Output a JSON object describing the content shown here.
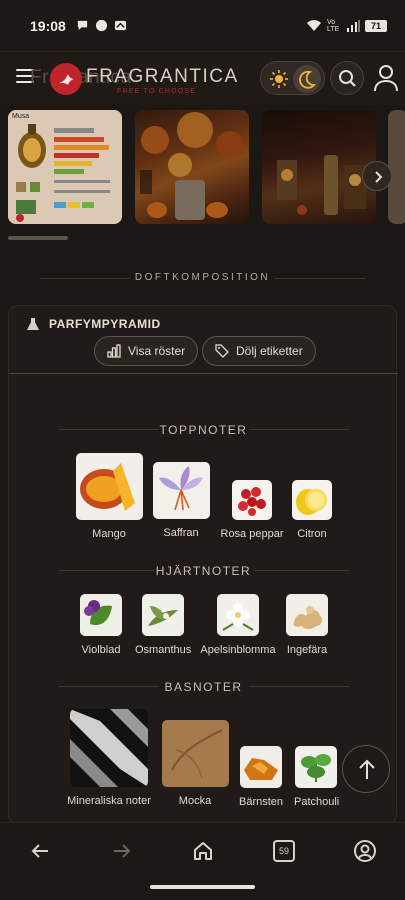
{
  "status_bar": {
    "time": "19:08",
    "network_label": "Vo LTE",
    "battery": "71"
  },
  "header": {
    "ghost_title": "Fragrantica",
    "brand": "FRAGRANTICA",
    "tagline": "FREE TO CHOOSE",
    "brand_color": "#c0242b"
  },
  "carousel": {
    "thumb1_title": "Musa"
  },
  "section": {
    "title": "DOFTKOMPOSITION"
  },
  "pyramid": {
    "title": "PARFYMPYRAMID",
    "show_votes_label": "Visa röster",
    "hide_tags_label": "Dölj etiketter",
    "top": {
      "title": "TOPPNOTER",
      "notes": [
        "Mango",
        "Saffran",
        "Rosa peppar",
        "Citron"
      ]
    },
    "heart": {
      "title": "HJÄRTNOTER",
      "notes": [
        "Violblad",
        "Osmanthus",
        "Apelsinblomma",
        "Ingefära"
      ]
    },
    "base": {
      "title": "BASNOTER",
      "notes": [
        "Mineraliska noter",
        "Mocka",
        "Bärnsten",
        "Patchouli"
      ]
    }
  },
  "bottom_nav": {
    "tabs_count": "59"
  }
}
